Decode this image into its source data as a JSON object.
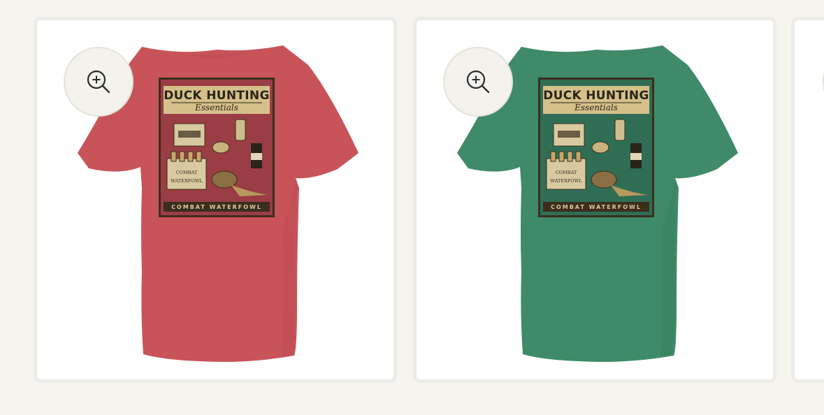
{
  "gallery": {
    "zoom_icon": "zoom-in-icon",
    "cards": [
      {
        "shirt_color": "#c8545a",
        "shirt_shade": "#b8484e",
        "panel_bg": "#9a3d45",
        "design": {
          "title": "DUCK HUNTING",
          "subtitle": "Essentials",
          "footer": "COMBAT WATERFOWL",
          "case_label_1": "COMBAT",
          "case_label_2": "WATERFOWL"
        }
      },
      {
        "shirt_color": "#3f8a68",
        "shirt_shade": "#357a5b",
        "panel_bg": "#2f6e55",
        "design": {
          "title": "DUCK HUNTING",
          "subtitle": "Essentials",
          "footer": "COMBAT WATERFOWL",
          "case_label_1": "COMBAT",
          "case_label_2": "WATERFOWL"
        }
      }
    ]
  }
}
